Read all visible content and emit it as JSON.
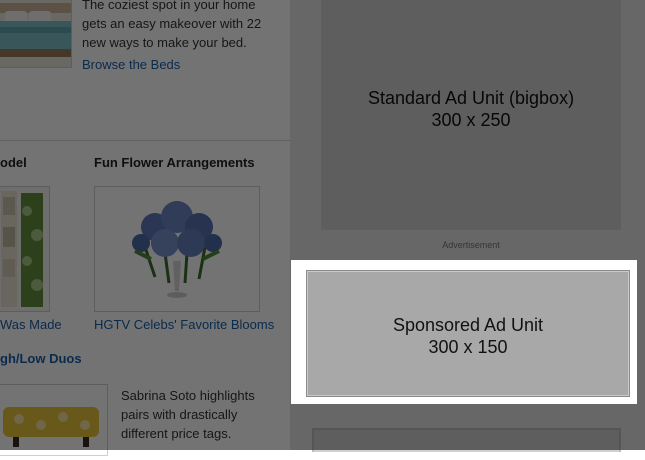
{
  "content": {
    "beds": {
      "description": "The coziest spot in your home gets an easy makeover with 22 new ways to make your bed.",
      "link": "Browse the Beds"
    },
    "remodel": {
      "heading_fragment": "odel",
      "link_fragment": "Was Made"
    },
    "flowers": {
      "heading": "Fun Flower Arrangements",
      "link": "HGTV Celebs' Favorite Blooms"
    },
    "high_low": {
      "heading_fragment": "gh/Low Duos",
      "description": "Sabrina Soto highlights pairs with drastically different price tags."
    }
  },
  "ads": {
    "standard_title": "Standard Ad Unit (bigbox)",
    "standard_size": "300 x 250",
    "caption": "Advertisement",
    "sponsored_title": "Sponsored Ad Unit",
    "sponsored_size": "300 x 150"
  },
  "colors": {
    "link": "#1a5fa8",
    "overlay": "rgba(0,0,0,0.55)",
    "ad_placeholder": "#d0d0d0",
    "sponsored_placeholder": "#a8a8a8"
  }
}
